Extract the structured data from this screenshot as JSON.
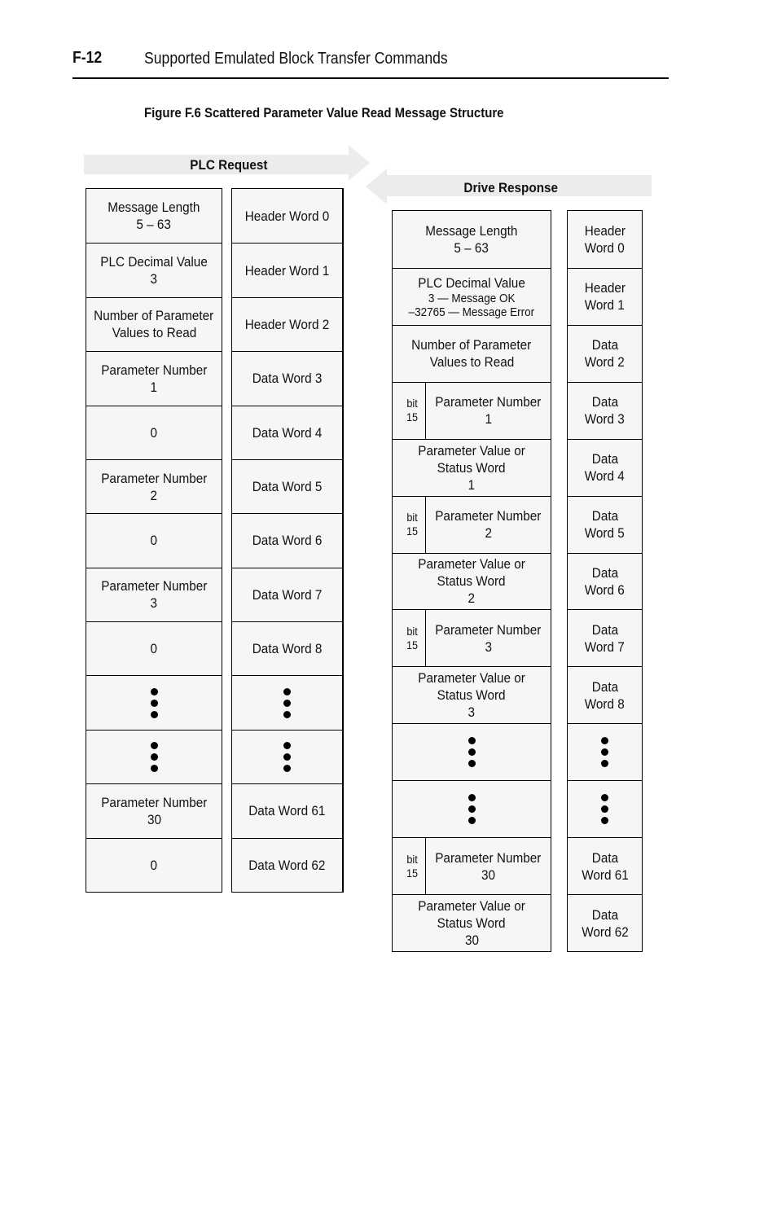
{
  "page": {
    "number": "F-12",
    "section_title": "Supported Emulated Block Transfer Commands"
  },
  "figure": {
    "title": "Figure F.6   Scattered Parameter Value Read Message Structure"
  },
  "plc_request": {
    "label": "PLC Request",
    "fields": [
      {
        "lines": [
          "Message Length",
          "5 – 63"
        ]
      },
      {
        "lines": [
          "PLC Decimal Value",
          "3"
        ]
      },
      {
        "lines": [
          "Number of Parameter",
          "Values to Read"
        ]
      },
      {
        "lines": [
          "Parameter Number",
          "1"
        ]
      },
      {
        "lines": [
          "0"
        ]
      },
      {
        "lines": [
          "Parameter Number",
          "2"
        ]
      },
      {
        "lines": [
          "0"
        ]
      },
      {
        "lines": [
          "Parameter Number",
          "3"
        ]
      },
      {
        "lines": [
          "0"
        ]
      },
      {
        "ellipsis": true
      },
      {
        "ellipsis": true
      },
      {
        "lines": [
          "Parameter Number",
          "30"
        ]
      },
      {
        "lines": [
          "0"
        ]
      }
    ],
    "words": [
      {
        "lines": [
          "Header Word 0"
        ]
      },
      {
        "lines": [
          "Header Word 1"
        ]
      },
      {
        "lines": [
          "Header Word 2"
        ]
      },
      {
        "lines": [
          "Data Word 3"
        ]
      },
      {
        "lines": [
          "Data Word 4"
        ]
      },
      {
        "lines": [
          "Data Word 5"
        ]
      },
      {
        "lines": [
          "Data Word 6"
        ]
      },
      {
        "lines": [
          "Data Word 7"
        ]
      },
      {
        "lines": [
          "Data Word 8"
        ]
      },
      {
        "ellipsis": true
      },
      {
        "ellipsis": true
      },
      {
        "lines": [
          "Data Word 61"
        ]
      },
      {
        "lines": [
          "Data Word 62"
        ]
      }
    ]
  },
  "drive_response": {
    "label": "Drive Response",
    "fields": [
      {
        "lines": [
          "Message Length",
          "5 – 63"
        ]
      },
      {
        "lines": [
          "PLC Decimal Value"
        ],
        "small_lines": [
          "3 — Message OK",
          "–32765 — Message Error"
        ]
      },
      {
        "lines": [
          "Number of Parameter",
          "Values to Read"
        ]
      },
      {
        "bit": [
          "bit",
          "15"
        ],
        "lines": [
          "Parameter Number",
          "1"
        ]
      },
      {
        "lines": [
          "Parameter Value or",
          "Status Word",
          "1"
        ]
      },
      {
        "bit": [
          "bit",
          "15"
        ],
        "lines": [
          "Parameter Number",
          "2"
        ]
      },
      {
        "lines": [
          "Parameter Value or",
          "Status Word",
          "2"
        ]
      },
      {
        "bit": [
          "bit",
          "15"
        ],
        "lines": [
          "Parameter Number",
          "3"
        ]
      },
      {
        "lines": [
          "Parameter Value or",
          "Status Word",
          "3"
        ]
      },
      {
        "ellipsis": true
      },
      {
        "ellipsis": true
      },
      {
        "bit": [
          "bit",
          "15"
        ],
        "lines": [
          "Parameter Number",
          "30"
        ]
      },
      {
        "lines": [
          "Parameter Value or",
          "Status Word",
          "30"
        ]
      }
    ],
    "words": [
      {
        "lines": [
          "Header",
          "Word 0"
        ]
      },
      {
        "lines": [
          "Header",
          "Word 1"
        ]
      },
      {
        "lines": [
          "Data",
          "Word 2"
        ]
      },
      {
        "lines": [
          "Data",
          "Word 3"
        ]
      },
      {
        "lines": [
          "Data",
          "Word 4"
        ]
      },
      {
        "lines": [
          "Data",
          "Word 5"
        ]
      },
      {
        "lines": [
          "Data",
          "Word 6"
        ]
      },
      {
        "lines": [
          "Data",
          "Word 7"
        ]
      },
      {
        "lines": [
          "Data",
          "Word 8"
        ]
      },
      {
        "ellipsis": true
      },
      {
        "ellipsis": true
      },
      {
        "lines": [
          "Data",
          "Word 61"
        ]
      },
      {
        "lines": [
          "Data",
          "Word 62"
        ]
      }
    ]
  },
  "colors": {
    "cell_fill": "#f6f6f6",
    "arrow_fill": "#ececec",
    "border": "#000000"
  }
}
